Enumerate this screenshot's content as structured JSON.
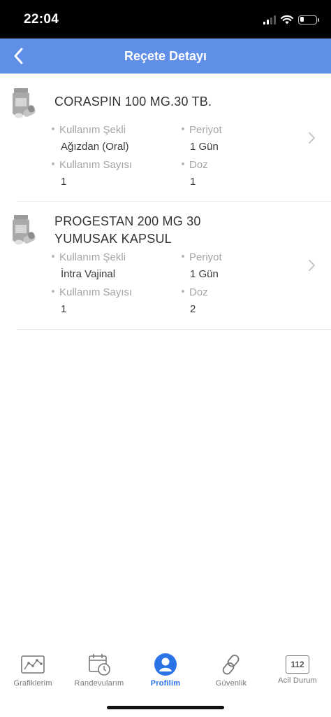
{
  "status_bar": {
    "time": "22:04"
  },
  "nav": {
    "title": "Reçete Detayı",
    "back_icon": "chevron-left-icon"
  },
  "prescriptions": [
    {
      "name": "CORASPIN 100 MG.30 TB.",
      "usage_type_label": "Kullanım Şekli",
      "usage_type": "Ağızdan (Oral)",
      "period_label": "Periyot",
      "period": "1 Gün",
      "usage_count_label": "Kullanım Sayısı",
      "usage_count": "1",
      "dose_label": "Doz",
      "dose": "1"
    },
    {
      "name": "PROGESTAN 200 MG 30 YUMUSAK KAPSUL",
      "usage_type_label": "Kullanım Şekli",
      "usage_type": "İntra Vajinal",
      "period_label": "Periyot",
      "period": "1 Gün",
      "usage_count_label": "Kullanım Sayısı",
      "usage_count": "1",
      "dose_label": "Doz",
      "dose": "2"
    }
  ],
  "tabs": [
    {
      "label": "Grafiklerim",
      "icon": "chart-icon"
    },
    {
      "label": "Randevularım",
      "icon": "calendar-clock-icon"
    },
    {
      "label": "Profilim",
      "icon": "profile-icon",
      "active": true
    },
    {
      "label": "Güvenlik",
      "icon": "chain-link-icon"
    },
    {
      "label": "Acil Durum",
      "icon": "emergency-112-icon",
      "badge": "112"
    }
  ],
  "colors": {
    "accent": "#5f8fe6",
    "active_tab": "#2b72e6"
  }
}
